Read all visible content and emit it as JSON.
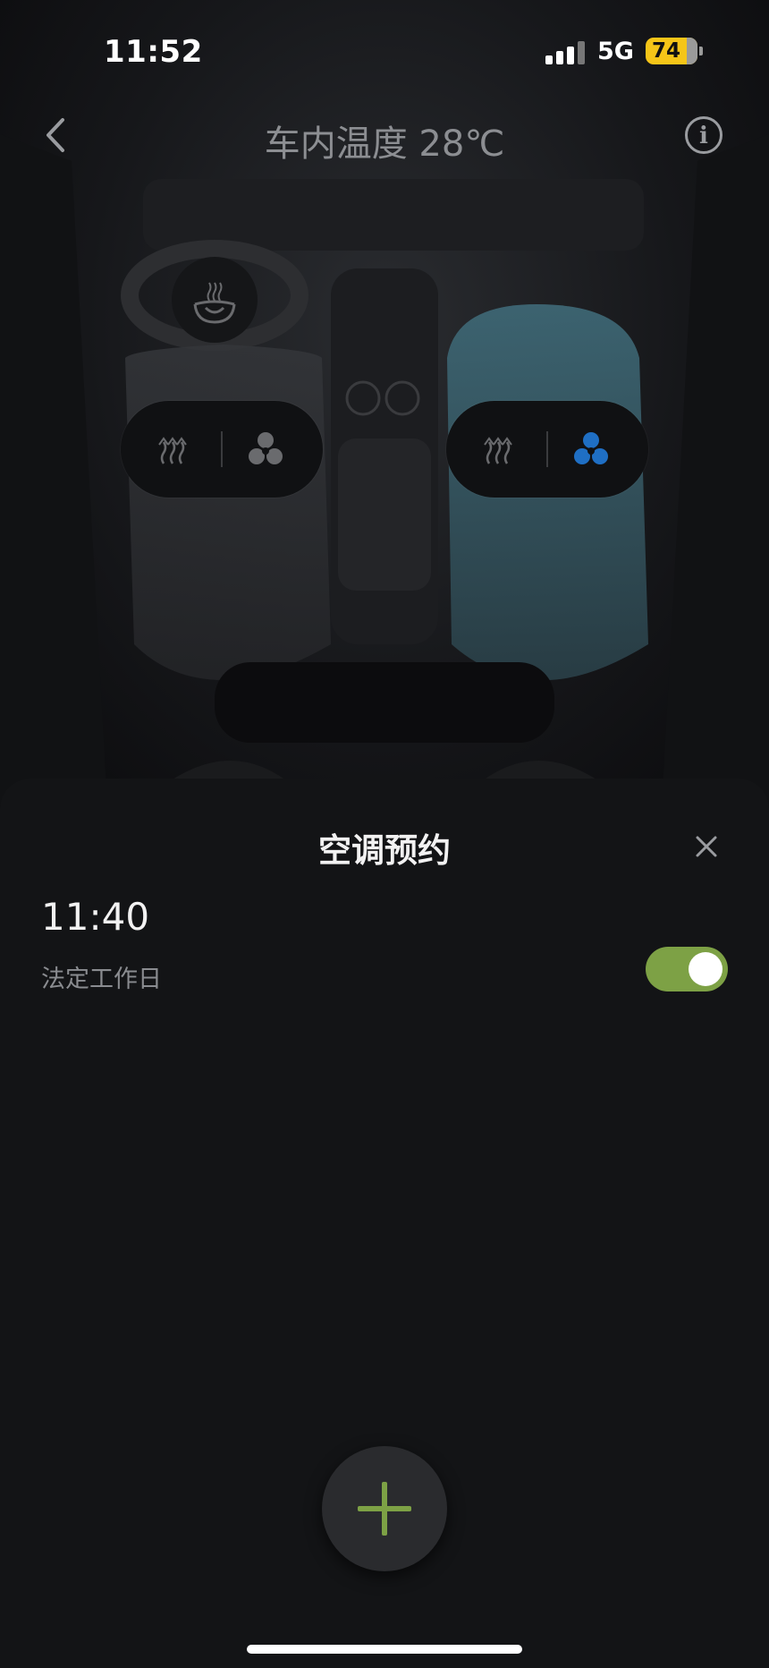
{
  "status_bar": {
    "time": "11:52",
    "network": "5G",
    "battery": "74"
  },
  "header": {
    "title": "车内温度 28℃",
    "back_icon": "chevron-left-icon",
    "info_icon": "info-icon"
  },
  "climate": {
    "steering_wheel_heat_icon": "steering-wheel-heat-icon",
    "driver_seat": {
      "heat_icon": "seat-heat-icon",
      "fan_icon": "fan-icon",
      "fan_active": false
    },
    "passenger_seat": {
      "heat_icon": "seat-heat-icon",
      "fan_icon": "fan-icon",
      "fan_active": true
    },
    "colors": {
      "fan_active": "#1f6fc4",
      "fan_inactive": "#6a6b6e",
      "passenger_seat_tint": "#3f6a78"
    }
  },
  "sheet": {
    "title": "空调预约",
    "close_icon": "close-icon",
    "schedules": [
      {
        "time": "11:40",
        "repeat": "法定工作日",
        "enabled": true
      }
    ],
    "add_icon": "plus-icon",
    "accent_color": "#7da145"
  }
}
